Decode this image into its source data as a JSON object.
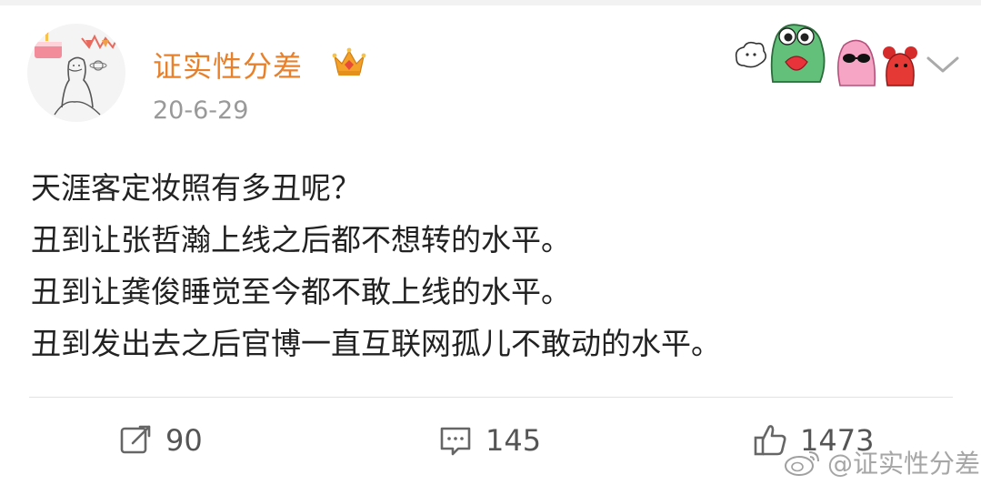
{
  "post": {
    "username": "证实性分差",
    "timestamp": "20-6-29",
    "lines": [
      "天涯客定妆照有多丑呢？",
      "丑到让张哲瀚上线之后都不想转的水平。",
      "丑到让龚俊睡觉至今都不敢上线的水平。",
      "丑到发出去之后官博一直互联网孤儿不敢动的水平。"
    ]
  },
  "actions": {
    "repost_count": "90",
    "comment_count": "145",
    "like_count": "1473"
  },
  "watermark": {
    "text": "@证实性分差"
  },
  "icons": {
    "avatar": "avatar-icon",
    "crown": "crown-icon",
    "sticker": "cartoon-sticker-icon",
    "chevron": "chevron-down-icon",
    "repost": "repost-icon",
    "comment": "comment-icon",
    "like": "thumbs-up-icon",
    "watermark_logo": "weibo-logo-icon"
  },
  "colors": {
    "username": "#e8812c",
    "timestamp": "#999999",
    "text": "#222222",
    "icon": "#666666"
  }
}
